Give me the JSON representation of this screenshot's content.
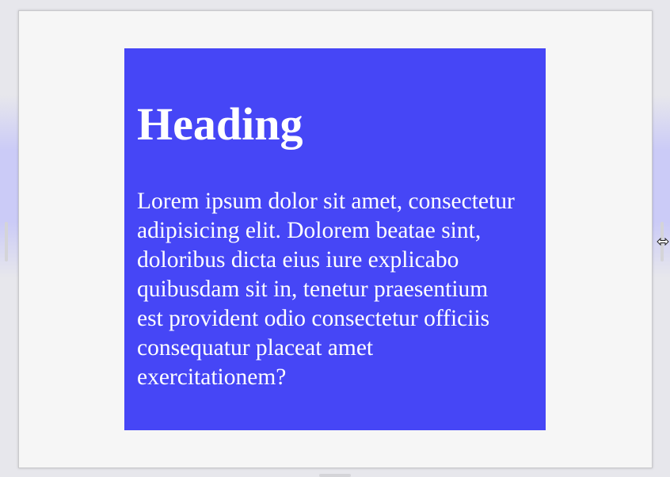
{
  "card": {
    "heading": "Heading",
    "paragraph": "Lorem ipsum dolor sit amet, consectetur adipisicing elit. Dolorem beatae sint, doloribus dicta eius iure explicabo quibusdam sit in, tenetur praesentium est provident odio consectetur officiis consequatur placeat amet exercitationem?"
  },
  "icons": {
    "resize": "horizontal-resize-icon"
  },
  "colors": {
    "card_background": "#4646f6",
    "card_text": "#ffffff",
    "frame_background": "#f6f6f6"
  }
}
